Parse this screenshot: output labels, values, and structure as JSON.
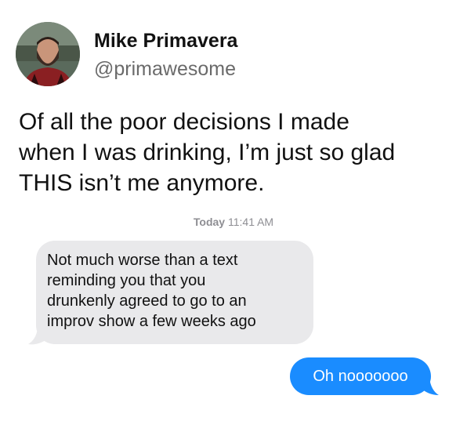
{
  "author": {
    "name": "Mike Primavera",
    "handle": "@primawesome"
  },
  "tweet": {
    "line1": "Of all the poor decisions I made",
    "line2": "when I was drinking, I’m just so glad",
    "line3": "THIS isn’t me anymore."
  },
  "conversation": {
    "timestamp_day": "Today",
    "timestamp_time": "11:41 AM",
    "received": {
      "line1": "Not much worse than a text",
      "line2": "reminding you that you",
      "line3": "drunkenly agreed to go to an",
      "line4": "improv show a few weeks ago"
    },
    "sent": {
      "text": "Oh nooooooo"
    }
  },
  "colors": {
    "received_bubble": "#e9e9eb",
    "sent_bubble": "#1a8cff",
    "timestamp": "#8e8e93",
    "handle": "#6a6a6a"
  }
}
